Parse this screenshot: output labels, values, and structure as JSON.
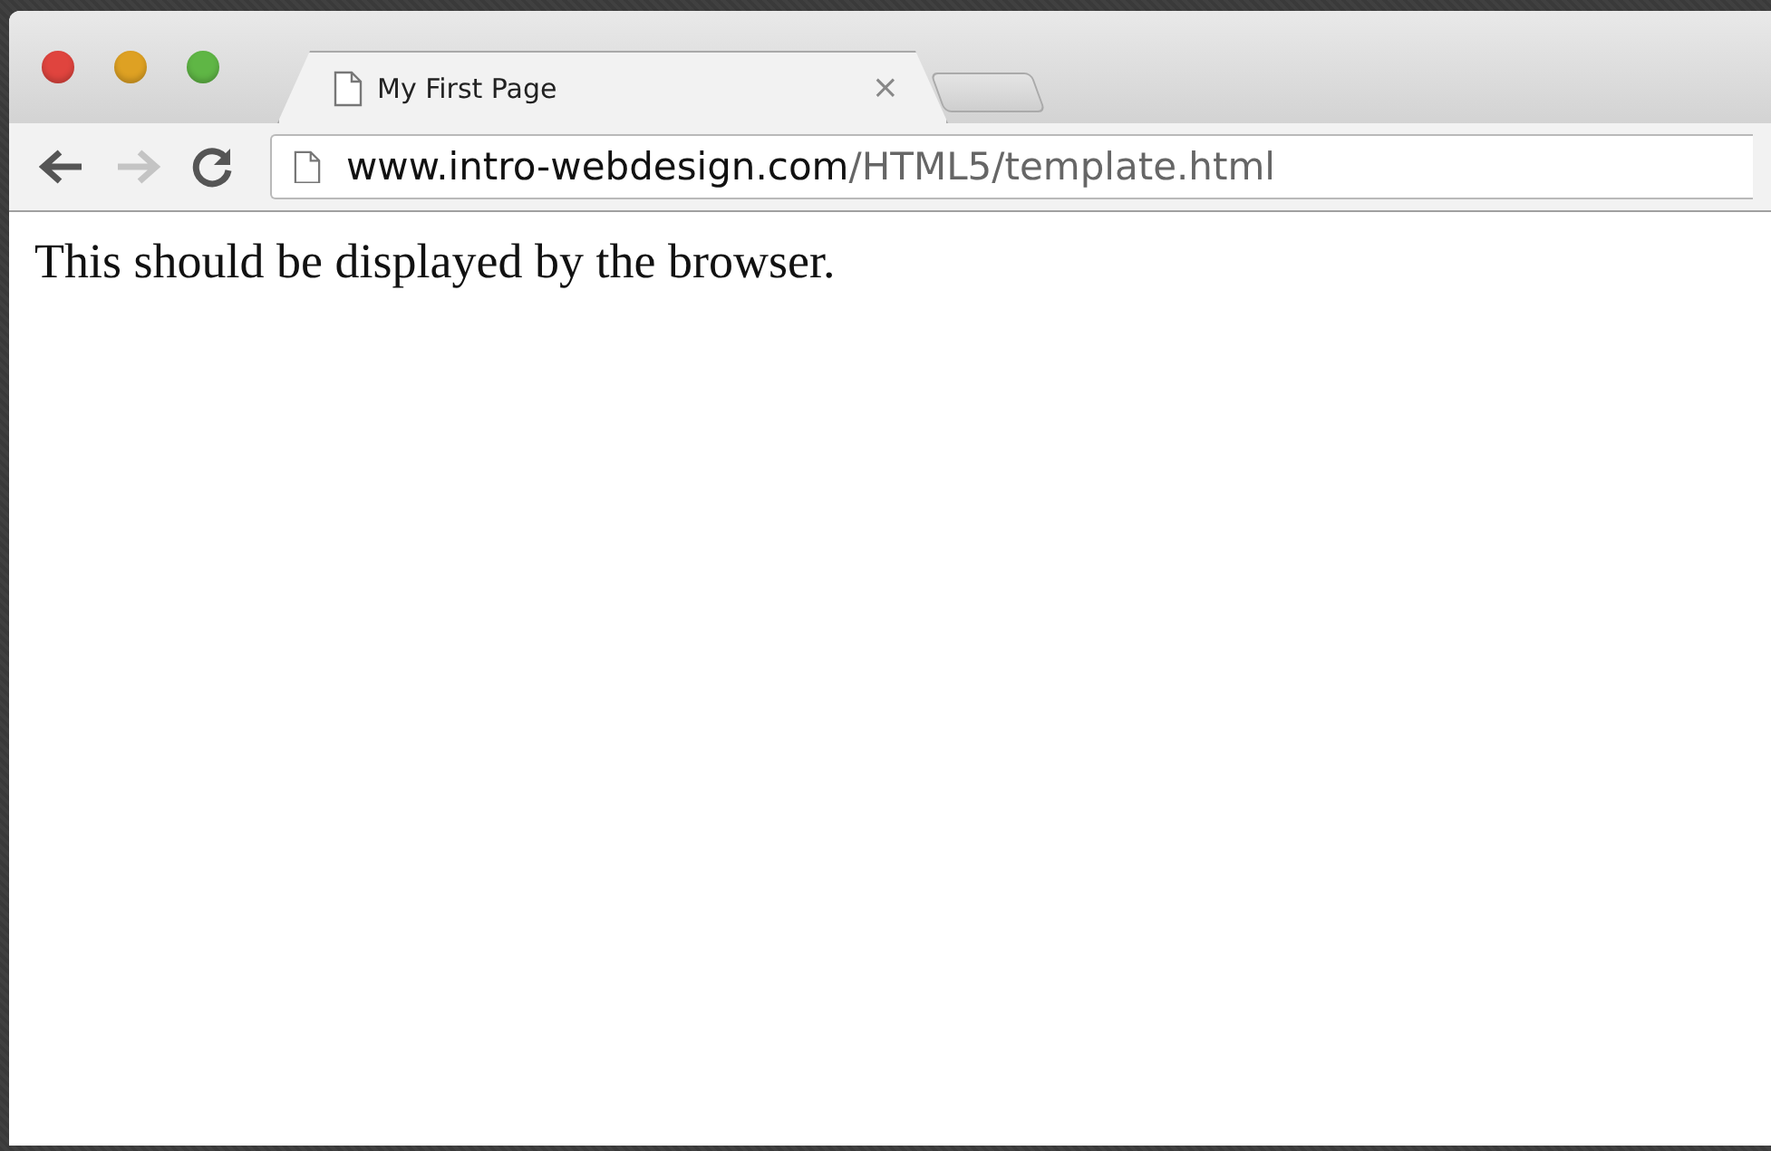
{
  "window": {
    "controls": [
      {
        "color": "#e0443e"
      },
      {
        "color": "#dea123"
      },
      {
        "color": "#5fb645"
      }
    ]
  },
  "tabs": [
    {
      "title": "My First Page",
      "close": "×",
      "selected": true
    }
  ],
  "toolbar": {
    "back_disabled": false,
    "forward_disabled": true
  },
  "address": {
    "host": "www.intro-webdesign.com",
    "path": "/HTML5/template.html"
  },
  "page": {
    "text": "This should be displayed by the browser."
  }
}
